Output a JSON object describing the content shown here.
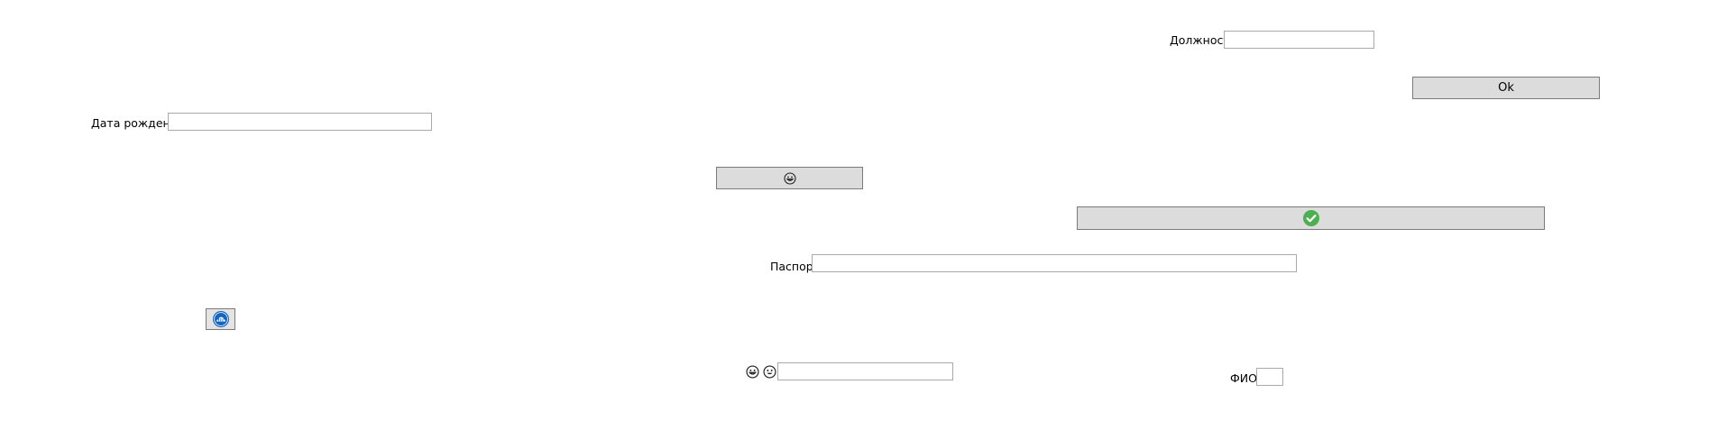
{
  "form": {
    "position_label": "Должность",
    "position_value": "",
    "ok_label": "Ok",
    "birthdate_label": "Дата рождения",
    "birthdate_value": "",
    "passport_label": "Паспорт",
    "passport_value": "",
    "fio_label": "ФИО",
    "fio_value": "",
    "emoji_field_value": ""
  },
  "icons": {
    "smiley_button_icon": "grinning-face-icon",
    "confirm_button_icon": "check-circle-icon",
    "cloud_button_icon": "blue-cloud-badge-icon",
    "emoji_label_icons": [
      "grinning-face-icon",
      "smiling-face-icon"
    ]
  },
  "colors": {
    "button_face": "#dcdcdc",
    "button_border": "#7a7a7a",
    "field_border": "#a9a9a9",
    "check_green": "#4caf50",
    "cloud_blue": "#1565c0"
  }
}
